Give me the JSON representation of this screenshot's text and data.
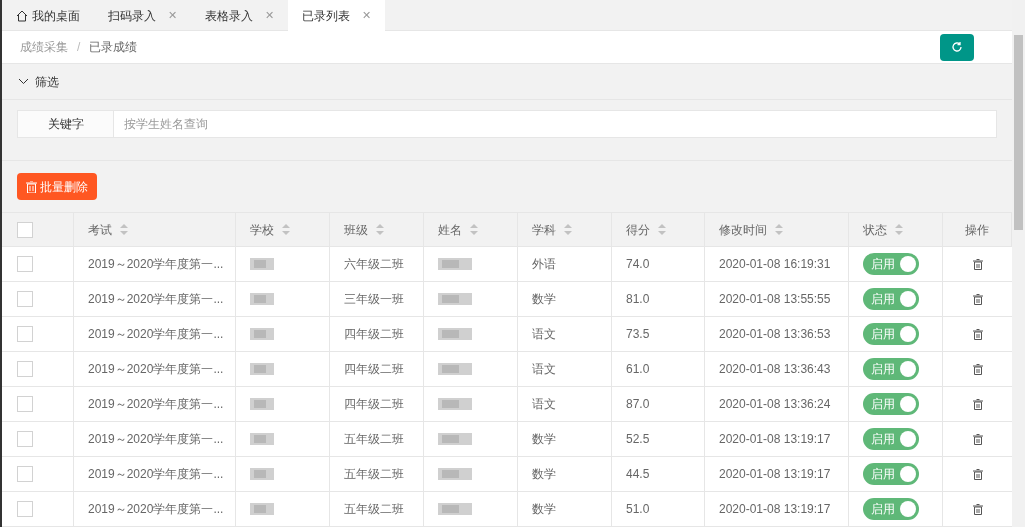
{
  "tabs": [
    {
      "label": "我的桌面",
      "kind": "home",
      "selected": false
    },
    {
      "label": "扫码录入",
      "kind": "closable",
      "selected": false
    },
    {
      "label": "表格录入",
      "kind": "closable",
      "selected": false
    },
    {
      "label": "已录列表",
      "kind": "closable",
      "selected": true
    }
  ],
  "close_glyph": "✕",
  "breadcrumb": [
    "成绩采集",
    "已录成绩"
  ],
  "breadcrumb_separator": "/",
  "filter": {
    "title": "筛选",
    "expanded": true,
    "field_label": "关键字",
    "placeholder": "按学生姓名查询"
  },
  "batch_delete_label": "批量删除",
  "table": {
    "select_all_checked": false,
    "columns": [
      {
        "label": "考试",
        "sortable": true
      },
      {
        "label": "学校",
        "sortable": true
      },
      {
        "label": "班级",
        "sortable": true
      },
      {
        "label": "姓名",
        "sortable": true
      },
      {
        "label": "学科",
        "sortable": true
      },
      {
        "label": "得分",
        "sortable": true
      },
      {
        "label": "修改时间",
        "sortable": true
      },
      {
        "label": "状态",
        "sortable": true
      },
      {
        "label": "操作",
        "sortable": false
      }
    ],
    "rows": [
      {
        "checked": false,
        "exam": "2019～2020学年度第一...",
        "class": "六年级二班",
        "subject": "外语",
        "score": "74.0",
        "time": "2020-01-08 16:19:31",
        "status": "启用",
        "on": true
      },
      {
        "checked": false,
        "exam": "2019～2020学年度第一...",
        "class": "三年级一班",
        "subject": "数学",
        "score": "81.0",
        "time": "2020-01-08 13:55:55",
        "status": "启用",
        "on": true
      },
      {
        "checked": false,
        "exam": "2019～2020学年度第一...",
        "class": "四年级二班",
        "subject": "语文",
        "score": "73.5",
        "time": "2020-01-08 13:36:53",
        "status": "启用",
        "on": true
      },
      {
        "checked": false,
        "exam": "2019～2020学年度第一...",
        "class": "四年级二班",
        "subject": "语文",
        "score": "61.0",
        "time": "2020-01-08 13:36:43",
        "status": "启用",
        "on": true
      },
      {
        "checked": false,
        "exam": "2019～2020学年度第一...",
        "class": "四年级二班",
        "subject": "语文",
        "score": "87.0",
        "time": "2020-01-08 13:36:24",
        "status": "启用",
        "on": true
      },
      {
        "checked": false,
        "exam": "2019～2020学年度第一...",
        "class": "五年级二班",
        "subject": "数学",
        "score": "52.5",
        "time": "2020-01-08 13:19:17",
        "status": "启用",
        "on": true
      },
      {
        "checked": false,
        "exam": "2019～2020学年度第一...",
        "class": "五年级二班",
        "subject": "数学",
        "score": "44.5",
        "time": "2020-01-08 13:19:17",
        "status": "启用",
        "on": true
      },
      {
        "checked": false,
        "exam": "2019～2020学年度第一...",
        "class": "五年级二班",
        "subject": "数学",
        "score": "51.0",
        "time": "2020-01-08 13:19:17",
        "status": "启用",
        "on": true
      }
    ]
  }
}
